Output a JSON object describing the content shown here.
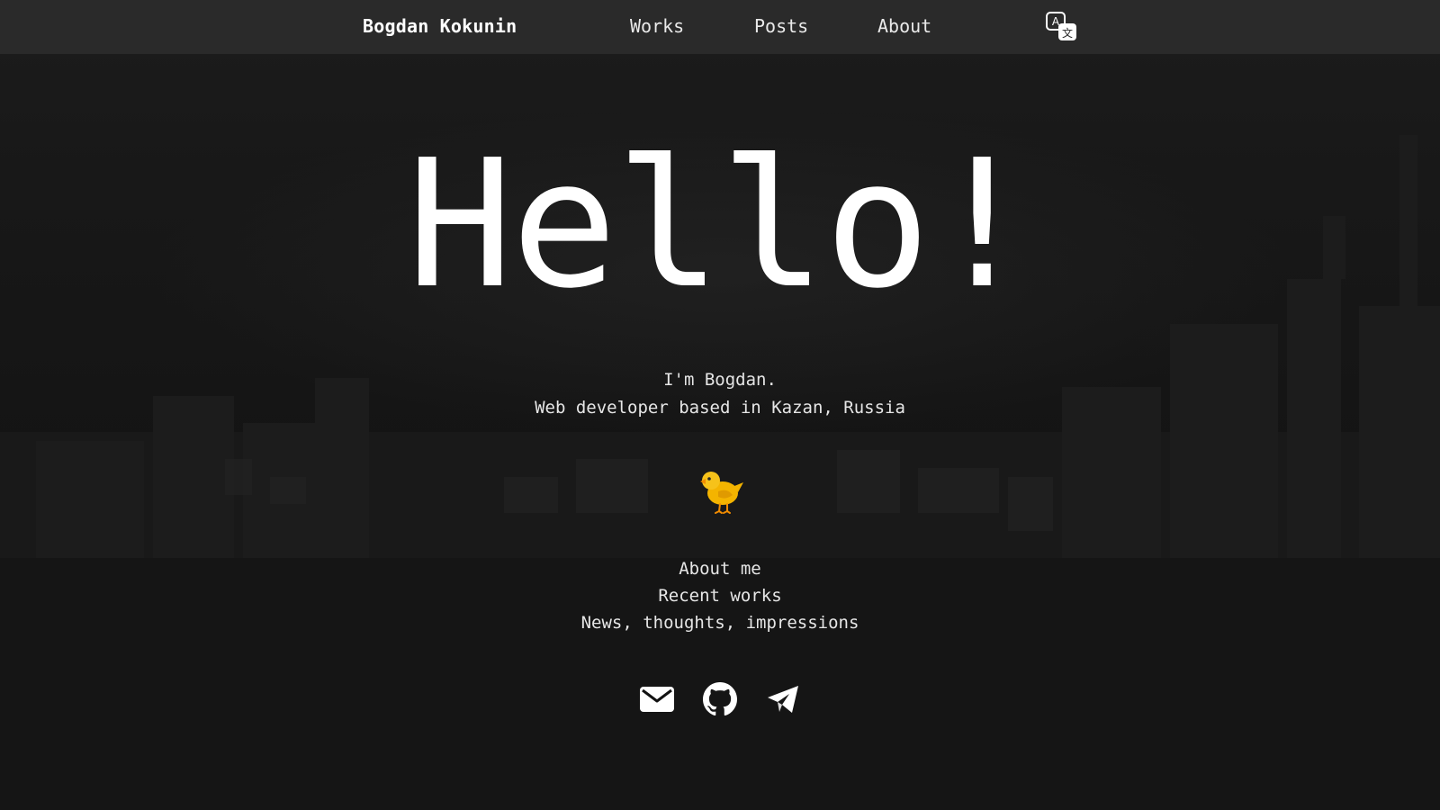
{
  "nav": {
    "brand": "Bogdan Kokunin",
    "links": [
      "Works",
      "Posts",
      "About"
    ],
    "language_icon": "translate-icon"
  },
  "hero": {
    "title": "Hello!",
    "intro_line1": "I'm Bogdan.",
    "intro_line2": "Web developer based in Kazan, Russia",
    "mascot_icon": "chick-icon"
  },
  "quick_links": [
    "About me",
    "Recent works",
    "News, thoughts, impressions"
  ],
  "socials": [
    {
      "icon": "mail-icon"
    },
    {
      "icon": "github-icon"
    },
    {
      "icon": "telegram-icon"
    }
  ],
  "colors": {
    "background": "#121212",
    "navbar": "#2a2a2a",
    "text": "#ffffff",
    "muted_text": "#e6e6e6",
    "chick": "#f4b400"
  }
}
